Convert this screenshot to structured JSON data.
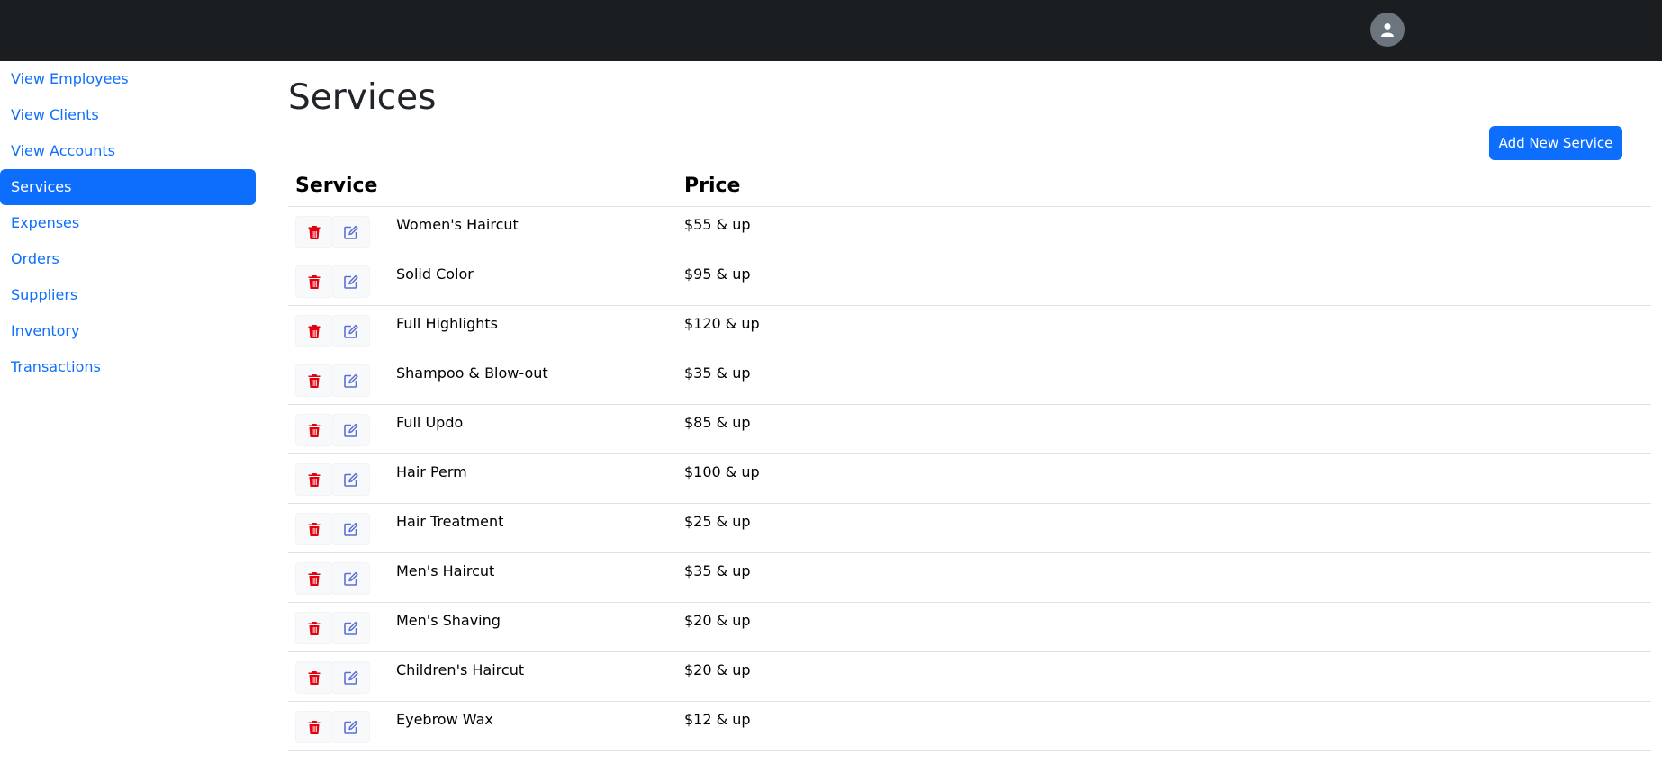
{
  "header": {
    "avatar_icon": "user-circle-icon"
  },
  "sidebar": {
    "items": [
      {
        "label": "View Employees",
        "active": false
      },
      {
        "label": "View Clients",
        "active": false
      },
      {
        "label": "View Accounts",
        "active": false
      },
      {
        "label": "Services",
        "active": true
      },
      {
        "label": "Expenses",
        "active": false
      },
      {
        "label": "Orders",
        "active": false
      },
      {
        "label": "Suppliers",
        "active": false
      },
      {
        "label": "Inventory",
        "active": false
      },
      {
        "label": "Transactions",
        "active": false
      }
    ]
  },
  "main": {
    "title": "Services",
    "add_button_label": "Add New Service",
    "table": {
      "columns": [
        "Service",
        "Price"
      ],
      "rows": [
        {
          "service": "Women's Haircut",
          "price": "$55 & up"
        },
        {
          "service": "Solid Color",
          "price": "$95 & up"
        },
        {
          "service": "Full Highlights",
          "price": "$120 & up"
        },
        {
          "service": "Shampoo & Blow-out",
          "price": "$35 & up"
        },
        {
          "service": "Full Updo",
          "price": "$85 & up"
        },
        {
          "service": "Hair Perm",
          "price": "$100 & up"
        },
        {
          "service": "Hair Treatment",
          "price": "$25 & up"
        },
        {
          "service": "Men's Haircut",
          "price": "$35 & up"
        },
        {
          "service": "Men's Shaving",
          "price": "$20 & up"
        },
        {
          "service": "Children's Haircut",
          "price": "$20 & up"
        },
        {
          "service": "Eyebrow Wax",
          "price": "$12 & up"
        }
      ]
    }
  },
  "colors": {
    "topbar": "#1b1e21",
    "accent": "#0d6efd",
    "delete_icon": "#e3000f",
    "edit_icon": "#5b6fd6"
  }
}
